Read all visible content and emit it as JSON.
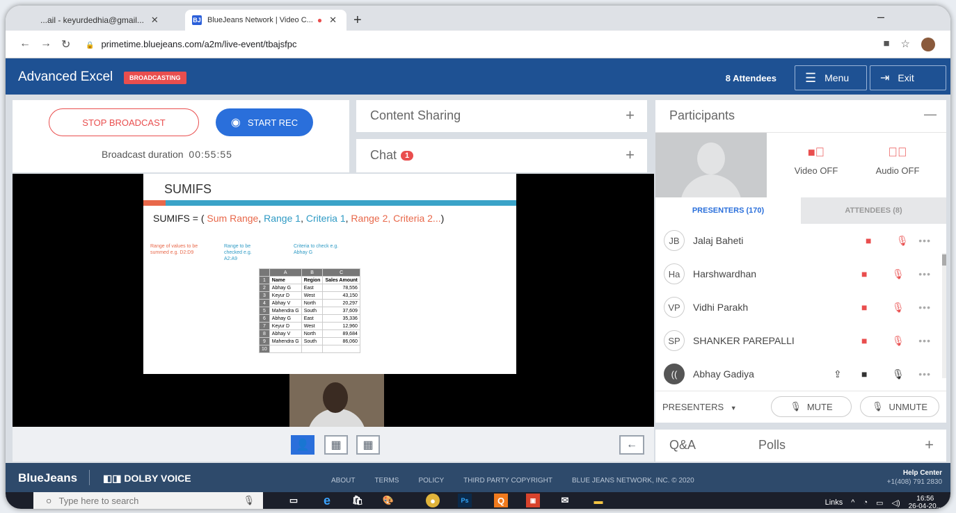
{
  "browser": {
    "tabs": [
      {
        "title": "...ail - keyurdedhia@gmail...",
        "active": false
      },
      {
        "title": "BlueJeans Network | Video C...",
        "active": true,
        "recording": true
      }
    ],
    "new_tab": "+",
    "url": "primetime.bluejeans.com/a2m/live-event/tbajsfpc"
  },
  "header": {
    "title": "Advanced Excel",
    "status_badge": "BROADCASTING",
    "attendees": "8 Attendees",
    "menu_label": "Menu",
    "exit_label": "Exit"
  },
  "broadcast": {
    "stop_label": "STOP BROADCAST",
    "rec_label": "START REC",
    "duration_label": "Broadcast duration",
    "duration": "00:55:55"
  },
  "content_sharing": {
    "label": "Content Sharing"
  },
  "chat": {
    "label": "Chat",
    "count": "1"
  },
  "slide": {
    "title": "SUMIFS",
    "formula_parts": [
      {
        "text": "SUMIFS = ( ",
        "color": "#222222"
      },
      {
        "text": "Sum Range",
        "color": "#e8684a"
      },
      {
        "text": ", ",
        "color": "#222222"
      },
      {
        "text": "Range 1",
        "color": "#2e9ac4"
      },
      {
        "text": ", ",
        "color": "#222222"
      },
      {
        "text": "Criteria 1",
        "color": "#2e9ac4"
      },
      {
        "text": ", ",
        "color": "#222222"
      },
      {
        "text": "Range 2, Criteria 2...",
        "color": "#e8684a"
      },
      {
        "text": ")",
        "color": "#222222"
      }
    ],
    "notes": [
      {
        "text": "Range of values to be summed e.g. D2:D9",
        "color": "#e8684a"
      },
      {
        "text": "Range to be checked e.g. A2:A9",
        "color": "#2e9ac4"
      },
      {
        "text": "Criteria to check e.g. Abhay G",
        "color": "#2e9ac4"
      }
    ],
    "table": {
      "col_letters": [
        "A",
        "B",
        "C"
      ],
      "rows": [
        [
          "1",
          "Name",
          "Region",
          "Sales Amount"
        ],
        [
          "2",
          "Abhay G",
          "East",
          "78,556"
        ],
        [
          "3",
          "Keyur D",
          "West",
          "43,150"
        ],
        [
          "4",
          "Abhay V",
          "North",
          "20,297"
        ],
        [
          "5",
          "Mahendra G",
          "South",
          "37,609"
        ],
        [
          "6",
          "Abhay G",
          "East",
          "35,336"
        ],
        [
          "7",
          "Keyur D",
          "West",
          "12,960"
        ],
        [
          "8",
          "Abhay V",
          "North",
          "89,684"
        ],
        [
          "9",
          "Mahendra G",
          "South",
          "86,060"
        ],
        [
          "10",
          "",
          "",
          ""
        ]
      ]
    }
  },
  "participants": {
    "title": "Participants",
    "video_off": "Video OFF",
    "audio_off": "Audio OFF",
    "tab_presenters": "PRESENTERS (170)",
    "tab_attendees": "ATTENDEES (8)",
    "list": [
      {
        "initials": "JB",
        "name": "Jalaj Baheti",
        "muted": true
      },
      {
        "initials": "Ha",
        "name": "Harshwardhan",
        "muted": true
      },
      {
        "initials": "VP",
        "name": "Vidhi Parakh",
        "muted": true
      },
      {
        "initials": "SP",
        "name": "SHANKER PAREPALLI",
        "muted": true
      },
      {
        "initials": "((",
        "name": "Abhay Gadiya",
        "muted": false
      }
    ],
    "filter": "PRESENTERS",
    "mute_label": "MUTE",
    "unmute_label": "UNMUTE"
  },
  "qa": {
    "qa_label": "Q&A",
    "polls_label": "Polls"
  },
  "footer": {
    "brand": "BlueJeans",
    "dolby": "DOLBY VOICE",
    "links": [
      "ABOUT",
      "TERMS",
      "POLICY",
      "THIRD PARTY COPYRIGHT",
      "BLUE JEANS NETWORK, INC. © 2020"
    ],
    "help_title": "Help Center",
    "help_phone": "+1(408) 791 2830"
  },
  "taskbar": {
    "search_placeholder": "Type here to search",
    "links": "Links",
    "time": "16:56",
    "date": "26-04-20..."
  },
  "colors": {
    "brand_blue": "#1e5193",
    "accent_red": "#e94e4e",
    "rec_blue": "#2a6fdb"
  }
}
